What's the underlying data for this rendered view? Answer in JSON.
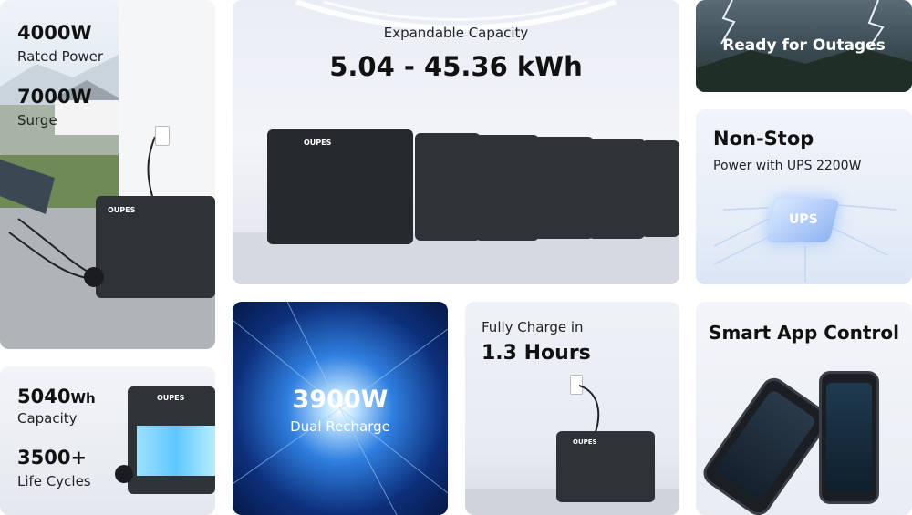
{
  "tiles": {
    "power": {
      "line1": "4000W",
      "line2": "Rated Power",
      "line3": "7000W",
      "line4": "Surge"
    },
    "capacity": {
      "label": "Expandable Capacity",
      "value": "5.04 - 45.36 kWh"
    },
    "outages": {
      "label": "Ready for Outages"
    },
    "ups": {
      "title": "Non-Stop",
      "subtitle": "Power with UPS 2200W",
      "chip_label": "UPS"
    },
    "battery": {
      "cap_value": "5040",
      "cap_unit": "Wh",
      "cap_label": "Capacity",
      "cycles_value": "3500+",
      "cycles_label": "Life Cycles"
    },
    "recharge": {
      "value": "3900W",
      "label": "Dual Recharge"
    },
    "fullcharge": {
      "label": "Fully Charge in",
      "value": "1.3 Hours"
    },
    "app": {
      "title": "Smart App Control"
    }
  },
  "brand": {
    "logo": "OUPES"
  },
  "colors": {
    "unit_body": "#2e3338",
    "ups_chip": "#9fc4ff",
    "recharge_blue": "#2f7fe0",
    "battery_cyan": "#5ec8ff"
  },
  "icons": [
    "wall-outlet-icon",
    "ups-chip-icon",
    "lightning-icon"
  ]
}
